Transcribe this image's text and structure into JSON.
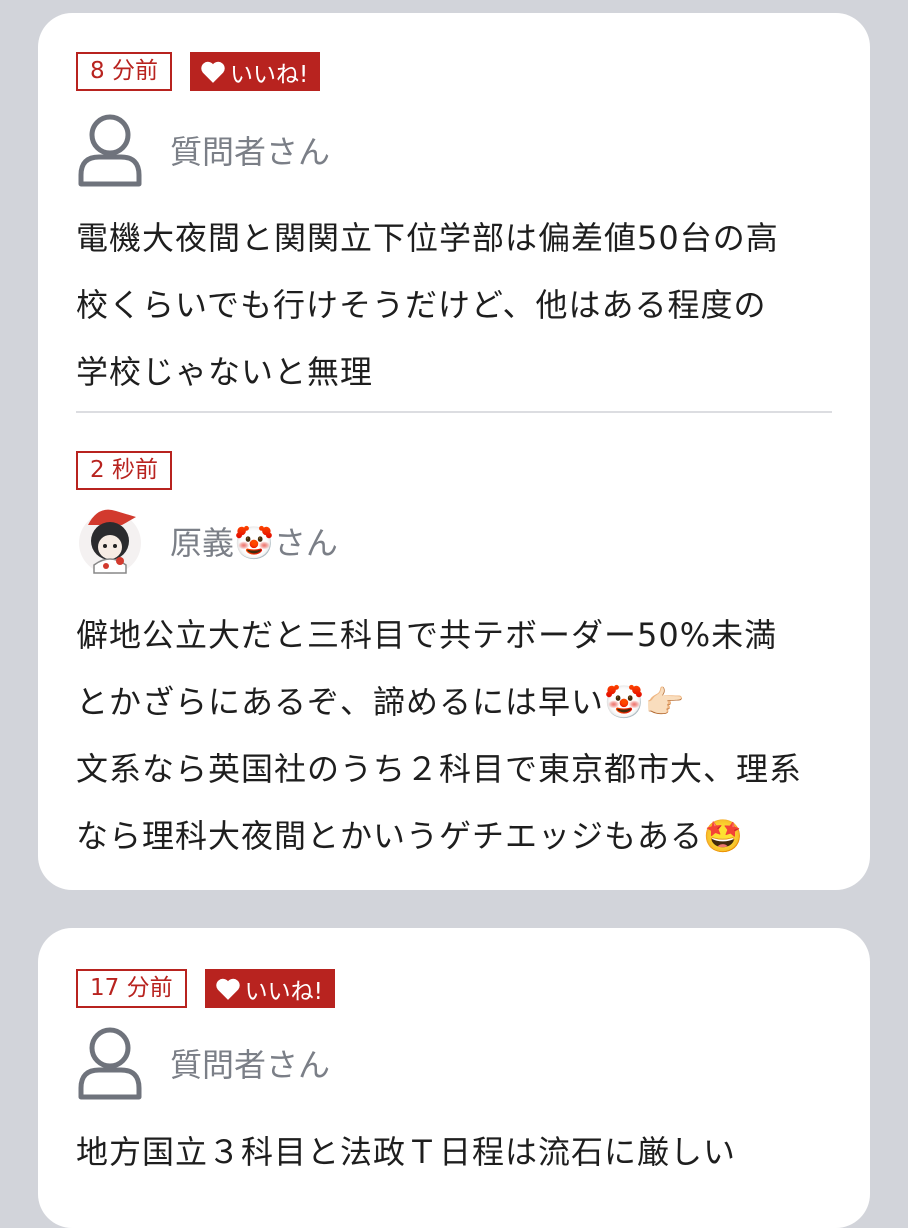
{
  "posts": [
    {
      "time": "8 分前",
      "like_label": "いいね!",
      "author": "質問者さん",
      "lines": [
        "電機大夜間と関関立下位学部は偏差値50台の高",
        "校くらいでも行けそうだけど、他はある程度の",
        "学校じゃないと無理"
      ]
    },
    {
      "time": "2 秒前",
      "author": "原義🤡さん",
      "lines": [
        "僻地公立大だと三科目で共テボーダー50%未満",
        "とかざらにあるぞ、諦めるには早い🤡👉🏻",
        "文系なら英国社のうち２科目で東京都市大、理系",
        "なら理科大夜間とかいうゲチエッジもある🤩"
      ]
    },
    {
      "time": "17 分前",
      "like_label": "いいね!",
      "author": "質問者さん",
      "lines": [
        "地方国立３科目と法政Ｔ日程は流石に厳しい"
      ]
    }
  ],
  "colors": {
    "accent": "#b8231f",
    "background": "#d2d4da",
    "card": "#ffffff",
    "author_text": "#7b7f87"
  },
  "icons": {
    "like": "heart-icon",
    "user_avatar": "person-outline-icon",
    "custom_avatar": "anime-character-avatar"
  }
}
